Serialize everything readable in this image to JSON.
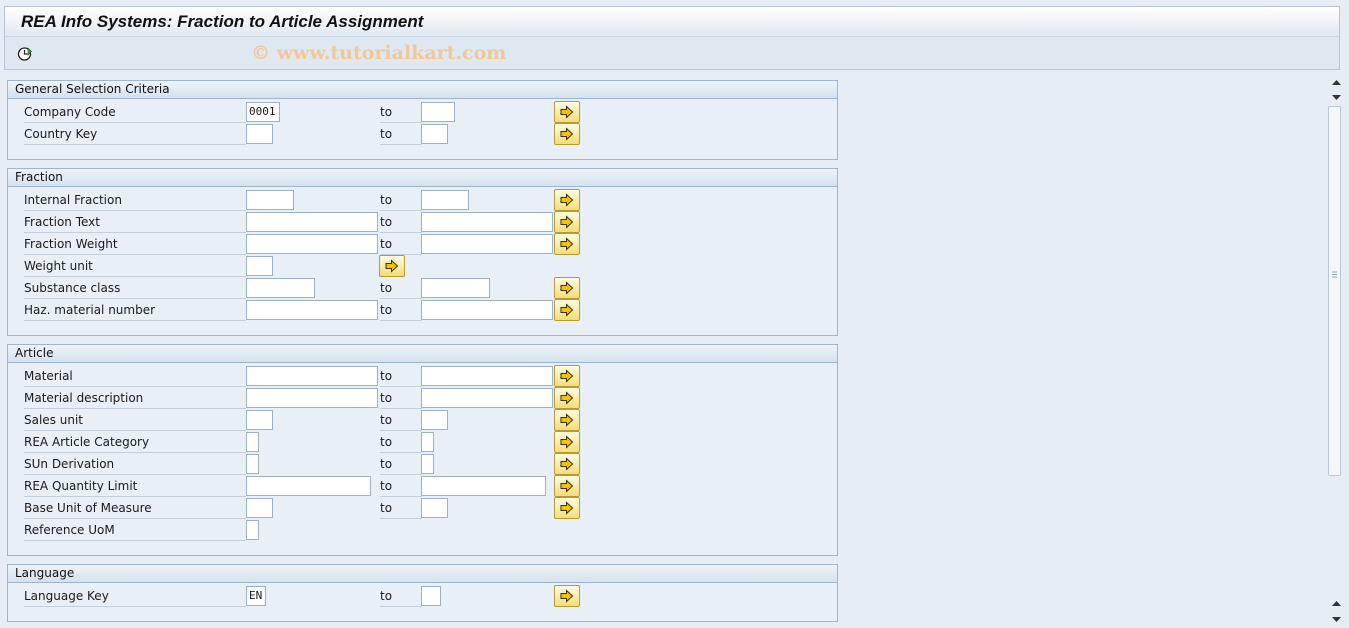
{
  "window": {
    "title": "REA Info Systems: Fraction to Article Assignment"
  },
  "toolbar": {
    "execute_icon": "execute-clock-icon"
  },
  "watermark": "© www.tutorialkart.com",
  "icons": {
    "multi_select": "arrow-right-icon"
  },
  "to_label": "to",
  "groups": {
    "general": {
      "title": "General Selection Criteria",
      "fields": [
        {
          "label": "Company Code",
          "from": "0001",
          "to": ""
        },
        {
          "label": "Country Key",
          "from": "",
          "to": ""
        }
      ]
    },
    "fraction": {
      "title": "Fraction",
      "fields": [
        {
          "label": "Internal Fraction",
          "from": "",
          "to": ""
        },
        {
          "label": "Fraction Text",
          "from": "",
          "to": ""
        },
        {
          "label": "Fraction Weight",
          "from": "",
          "to": ""
        },
        {
          "label": "Weight unit",
          "from": ""
        },
        {
          "label": "Substance class",
          "from": "",
          "to": ""
        },
        {
          "label": "Haz. material number",
          "from": "",
          "to": ""
        }
      ]
    },
    "article": {
      "title": "Article",
      "fields": [
        {
          "label": "Material",
          "from": "",
          "to": ""
        },
        {
          "label": "Material description",
          "from": "",
          "to": ""
        },
        {
          "label": "Sales unit",
          "from": "",
          "to": ""
        },
        {
          "label": "REA Article Category",
          "from": "",
          "to": ""
        },
        {
          "label": "SUn Derivation",
          "from": "",
          "to": ""
        },
        {
          "label": "REA Quantity Limit",
          "from": "",
          "to": ""
        },
        {
          "label": "Base Unit of Measure",
          "from": "",
          "to": ""
        },
        {
          "label": "Reference UoM",
          "from": ""
        }
      ]
    },
    "language": {
      "title": "Language",
      "fields": [
        {
          "label": "Language Key",
          "from": "EN",
          "to": ""
        }
      ]
    }
  }
}
